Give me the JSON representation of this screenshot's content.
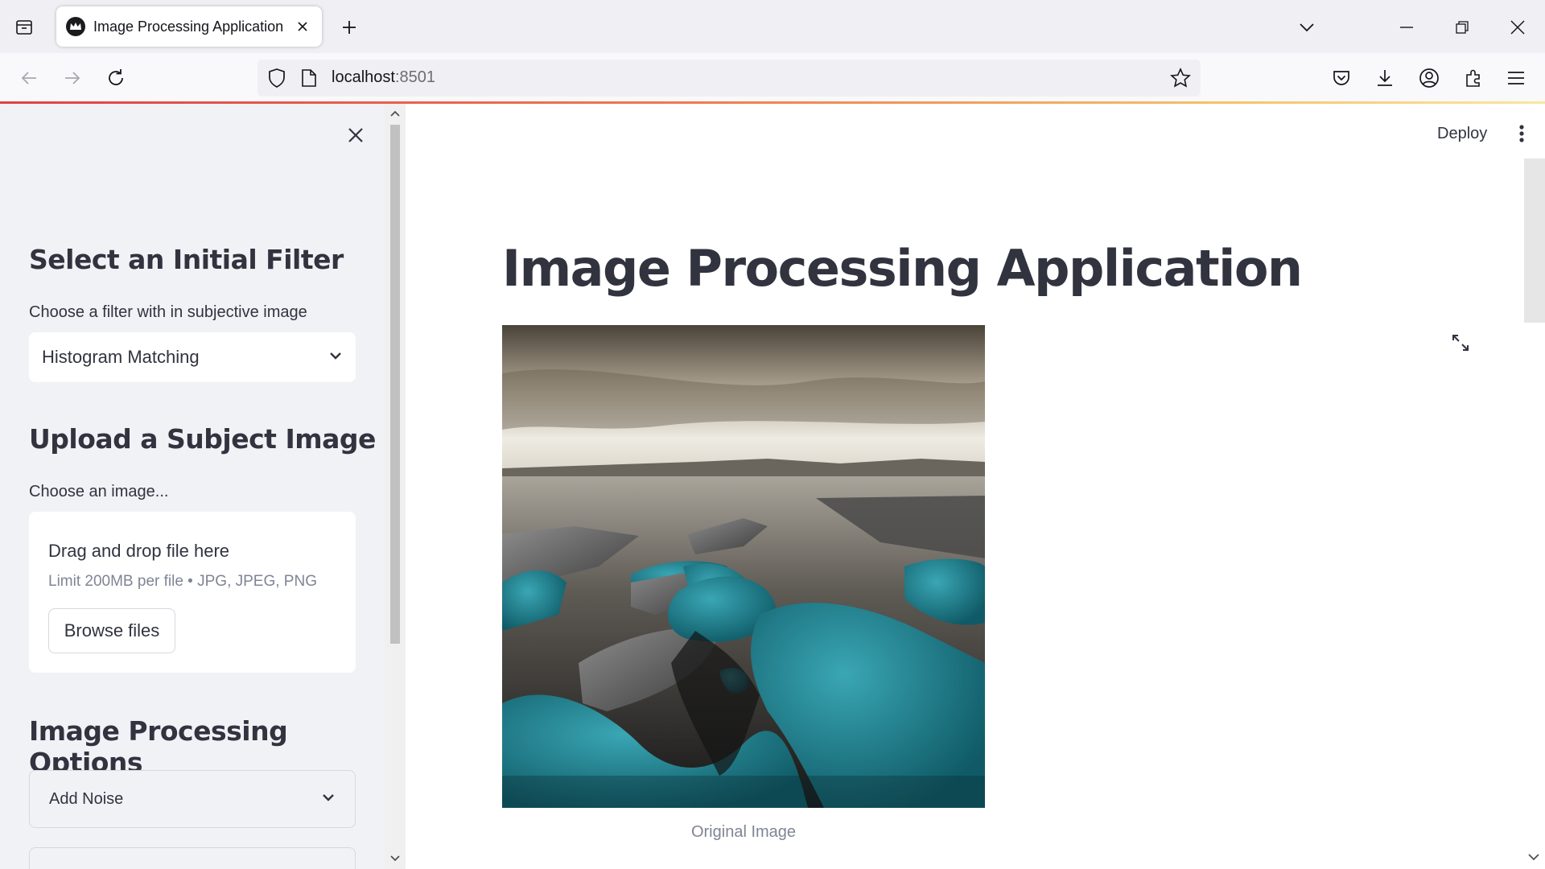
{
  "browser": {
    "tab_title": "Image Processing Application",
    "url_host": "localhost",
    "url_port": ":8501"
  },
  "sidebar": {
    "filter_heading": "Select an Initial Filter",
    "filter_label": "Choose a filter with in subjective image",
    "filter_selected": "Histogram Matching",
    "upload_heading": "Upload a Subject Image",
    "upload_label": "Choose an image...",
    "drop_title": "Drag and drop file here",
    "drop_limit": "Limit 200MB per file • JPG, JPEG, PNG",
    "browse_label": "Browse files",
    "options_heading": "Image Processing Options",
    "options_expander": "Add Noise"
  },
  "main": {
    "deploy_label": "Deploy",
    "title": "Image Processing Application",
    "image_caption": "Original Image"
  },
  "icons": {
    "tab_list": "tab-list-icon",
    "favicon": "streamlit-crown-icon",
    "tab_close": "close-icon",
    "new_tab": "plus-icon",
    "back": "arrow-left-icon",
    "forward": "arrow-right-icon",
    "reload": "reload-icon",
    "shield": "shield-icon",
    "page": "page-icon",
    "star": "star-icon",
    "pocket": "pocket-icon",
    "download": "download-icon",
    "account": "account-icon",
    "extensions": "puzzle-icon",
    "app_menu": "hamburger-icon",
    "fullscreen": "expand-icon",
    "kebab": "kebab-menu-icon"
  },
  "colors": {
    "text": "#31333f",
    "sidebar_bg": "#f0f2f6",
    "muted": "#808495",
    "loadbar_start": "#e0404a",
    "loadbar_end": "#f9e7a0"
  }
}
